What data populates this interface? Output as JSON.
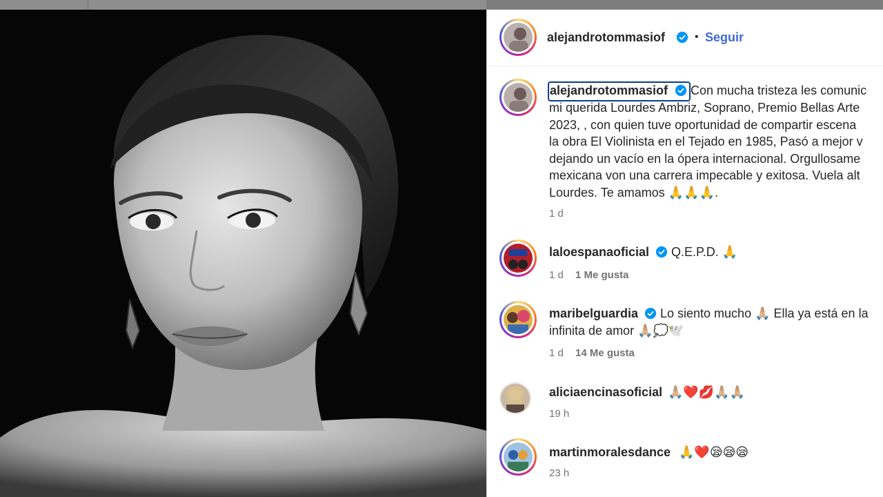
{
  "post": {
    "author": "alejandrotommasiof",
    "follow_label": "Seguir",
    "separator": "•",
    "caption_lines": [
      "Con mucha tristeza les comunic",
      "mi querida Lourdes Ambriz, Soprano, Premio Bellas Arte",
      "2023, , con quien tuve oportunidad de compartir escena",
      "la obra El Violinista en el Tejado en 1985, Pasó a mejor v",
      "dejando un vacío en la ópera internacional. Orgullosame",
      "mexicana von una carrera impecable y exitosa. Vuela alt",
      "Lourdes. Te amamos 🙏🙏🙏."
    ],
    "caption_time": "1 d"
  },
  "comments": [
    {
      "user": "laloespanaoficial",
      "verified": true,
      "lines": [
        "Q.E.P.D. 🙏"
      ],
      "time": "1 d",
      "likes": "1 Me gusta"
    },
    {
      "user": "maribelguardia",
      "verified": true,
      "lines": [
        "Lo siento mucho 🙏🏼 Ella ya está en la",
        "infinita de amor 🙏🏼💭🕊️"
      ],
      "time": "1 d",
      "likes": "14 Me gusta"
    },
    {
      "user": "aliciaencinasoficial",
      "verified": false,
      "lines": [
        "🙏🏼❤️💋🙏🏼🙏🏼"
      ],
      "time": "19 h",
      "likes": ""
    },
    {
      "user": "martinmoralesdance",
      "verified": false,
      "lines": [
        "🙏❤️😪😪😪"
      ],
      "time": "23 h",
      "likes": ""
    }
  ],
  "icons": {
    "verified": "verified-badge-icon",
    "avatar": "profile-avatar"
  },
  "colors": {
    "verified": "#0095f6",
    "follow": "#3f6ad8",
    "muted": "#737373"
  }
}
